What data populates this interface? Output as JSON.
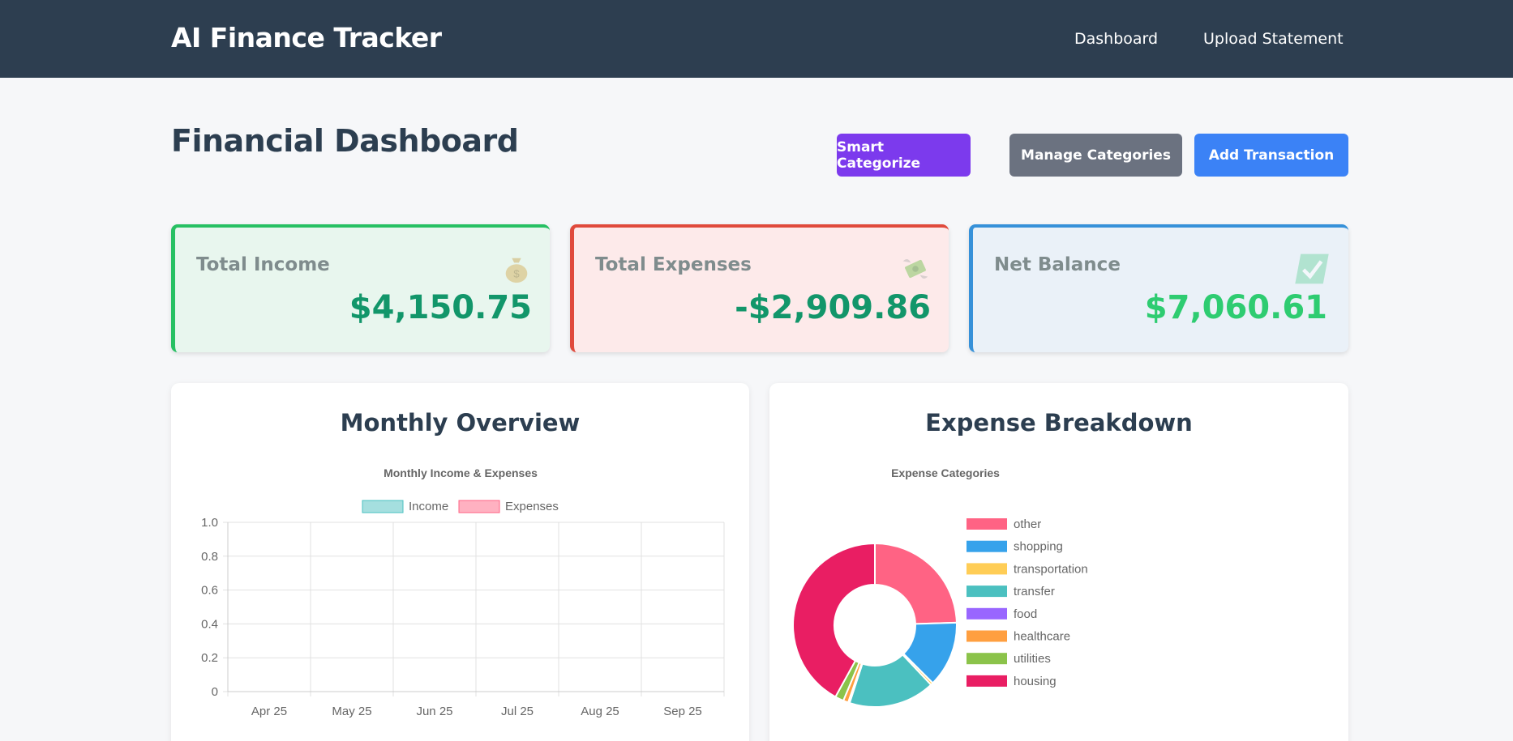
{
  "nav": {
    "brand": "AI Finance Tracker",
    "links": [
      "Dashboard",
      "Upload Statement"
    ]
  },
  "page": {
    "title": "Financial Dashboard"
  },
  "actions": {
    "smart_categorize": "Smart Categorize",
    "manage_categories": "Manage Categories",
    "add_transaction": "Add Transaction"
  },
  "summary": {
    "income": {
      "label": "Total Income",
      "value": "$4,150.75",
      "icon": "money-bag-icon"
    },
    "expenses": {
      "label": "Total Expenses",
      "value": "-$2,909.86",
      "icon": "money-with-wings-icon"
    },
    "net": {
      "label": "Net Balance",
      "value": "$7,060.61",
      "icon": "check-mark-icon"
    }
  },
  "colors": {
    "navbar": "#2d3e50",
    "income_accent": "#27c063",
    "expense_accent": "#e04a3c",
    "net_accent": "#3691d9",
    "btn_purple": "#7c3aed",
    "btn_gray": "#6b7280",
    "btn_blue": "#3b82f6"
  },
  "panels": {
    "monthly": {
      "title": "Monthly Overview"
    },
    "breakdown": {
      "title": "Expense Breakdown"
    }
  },
  "chart_data": [
    {
      "type": "bar",
      "title": "Monthly Income & Expenses",
      "categories": [
        "Apr 25",
        "May 25",
        "Jun 25",
        "Jul 25",
        "Aug 25",
        "Sep 25"
      ],
      "series": [
        {
          "name": "Income",
          "values": [
            0,
            0,
            0,
            0,
            0,
            0
          ],
          "color": "#4bc0c0"
        },
        {
          "name": "Expenses",
          "values": [
            0,
            0,
            0,
            0,
            0,
            0
          ],
          "color": "#ff6384"
        }
      ],
      "ylim": [
        0,
        1.0
      ],
      "yticks": [
        "0",
        "0.2",
        "0.4",
        "0.6",
        "0.8",
        "1.0"
      ],
      "grid": true,
      "legend": "top"
    },
    {
      "type": "pie",
      "title": "Expense Categories",
      "labels": [
        "other",
        "shopping",
        "transportation",
        "transfer",
        "food",
        "healthcare",
        "utilities",
        "housing"
      ],
      "values": [
        24.5,
        13.0,
        0.5,
        17.0,
        0.3,
        1.0,
        1.7,
        42.0
      ],
      "colors": [
        "#ff6384",
        "#36a2eb",
        "#ffcd56",
        "#4bc0c0",
        "#9966ff",
        "#ff9f40",
        "#8bc34a",
        "#e91e63"
      ],
      "legend": "right"
    }
  ]
}
